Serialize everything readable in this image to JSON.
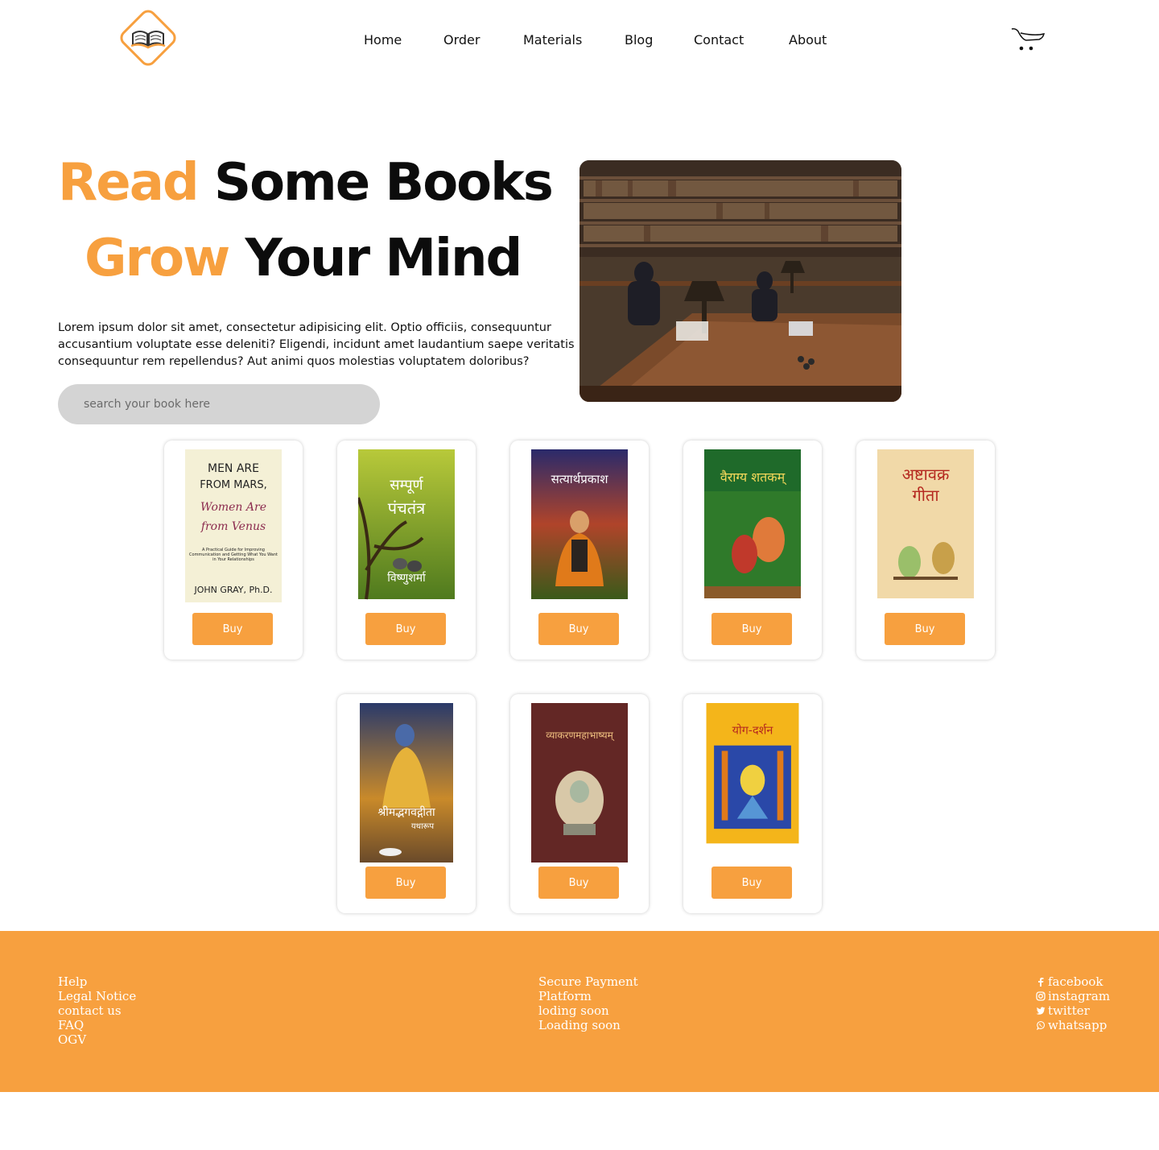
{
  "header": {
    "logo_alt": "book logo",
    "nav": [
      "Home",
      "Order",
      "Materials",
      "Blog",
      "Contact",
      "About"
    ],
    "cart_icon": "shopping-cart-icon"
  },
  "hero": {
    "title_line1_accent": "Read",
    "title_line1_rest": "Some Books",
    "title_line2_accent": "Grow",
    "title_line2_rest": "Your Mind",
    "description": "Lorem ipsum dolor sit amet, consectetur adipisicing elit. Optio officiis, consequuntur accusantium voluptate esse deleniti? Eligendi, incidunt amet laudantium saepe veritatis consequuntur rem repellendus? Aut animi quos molestias voluptatem doloribus?",
    "search_placeholder": "search your book here",
    "image": "library-reading-room-photo"
  },
  "books": [
    {
      "cover_texts": [
        "MEN ARE",
        "FROM MARS,",
        "Women Are",
        "from Venus",
        "A Practical Guide for Improving Communication and Getting What You Want in Your Relationships",
        "JOHN GRAY, Ph.D."
      ],
      "buy_label": "Buy"
    },
    {
      "cover_texts": [
        "सम्पूर्ण",
        "पंचतंत्र",
        "विष्णुशर्मा"
      ],
      "buy_label": "Buy"
    },
    {
      "cover_texts": [
        "सत्यार्थप्रकाश"
      ],
      "buy_label": "Buy"
    },
    {
      "cover_texts": [
        "वैराग्य शतकम्"
      ],
      "buy_label": "Buy"
    },
    {
      "cover_texts": [
        "अष्टावक्र",
        "गीता"
      ],
      "buy_label": "Buy"
    },
    {
      "cover_texts": [
        "श्रीमद्भगवद्गीता",
        "यथारूप"
      ],
      "buy_label": "Buy"
    },
    {
      "cover_texts": [
        "व्याकरणमहाभाष्यम्"
      ],
      "buy_label": "Buy"
    },
    {
      "cover_texts": [
        "योग-दर्शन"
      ],
      "buy_label": "Buy"
    }
  ],
  "footer": {
    "col1": [
      "Help",
      "Legal Notice",
      "contact us",
      "FAQ",
      "OGV"
    ],
    "col2": [
      "Secure Payment",
      "Platform",
      "loding soon",
      "Loading soon"
    ],
    "social": [
      {
        "label": "facebook",
        "icon": "facebook-icon"
      },
      {
        "label": "instagram",
        "icon": "instagram-icon"
      },
      {
        "label": "twitter",
        "icon": "twitter-icon"
      },
      {
        "label": "whatsapp",
        "icon": "whatsapp-icon"
      }
    ],
    "bg_color": "#F7A03F"
  },
  "colors": {
    "accent": "#F7A03F",
    "text": "#111111",
    "search_bg": "#d4d4d4"
  }
}
